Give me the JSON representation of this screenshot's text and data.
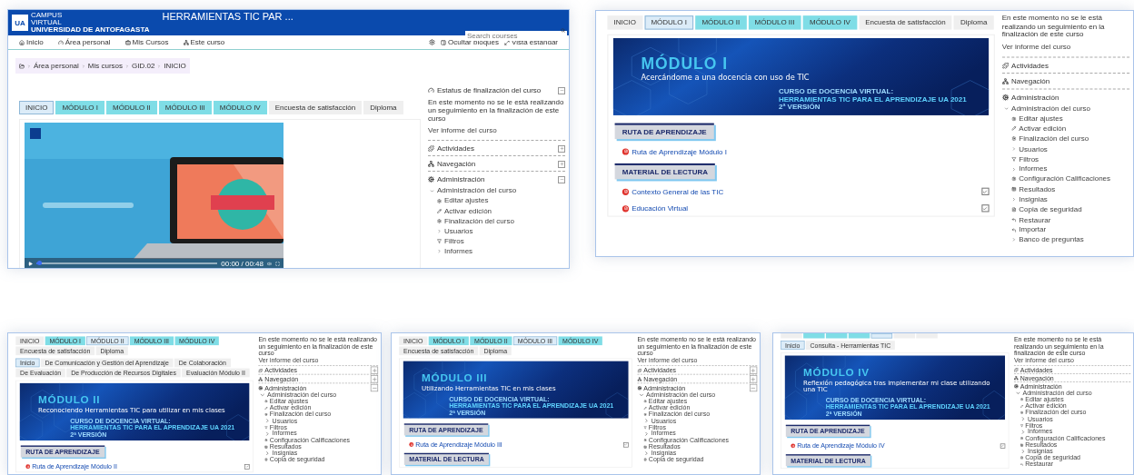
{
  "panels": [
    {
      "header": {
        "logo": "UA",
        "logo_lines": [
          "CAMPUS",
          "VIRTUAL",
          "UNIVERSIDAD DE ANTOFAGASTA"
        ],
        "title": "HERRAMIENTAS TIC PAR ...",
        "search_placeholder": "Search courses"
      },
      "nav": [
        "Inicio",
        "Área personal",
        "Mis Cursos",
        "Este curso"
      ],
      "nav_right": [
        "Ocultar bloques",
        "Vista estándar"
      ],
      "breadcrumb": [
        "Área personal",
        "Mis cursos",
        "GID.02",
        "INICIO"
      ],
      "tabs": [
        {
          "label": "INICIO",
          "kind": "page",
          "selected": true
        },
        {
          "label": "MÓDULO I",
          "kind": "module",
          "selected": false
        },
        {
          "label": "MÓDULO II",
          "kind": "module",
          "selected": false
        },
        {
          "label": "MÓDULO III",
          "kind": "module",
          "selected": false
        },
        {
          "label": "MÓDULO IV",
          "kind": "module",
          "selected": false
        },
        {
          "label": "Encuesta de satisfacción",
          "kind": "page",
          "selected": false
        },
        {
          "label": "Diploma",
          "kind": "page",
          "selected": false
        }
      ],
      "content": {
        "kind": "video",
        "time": "00:00 / 00:48",
        "level": 0.02
      },
      "sidebar": {
        "status": {
          "title": "Estatus de finalización del curso",
          "text": "En este momento no se le está realizando un seguimiento en la finalización de este curso",
          "link": "Ver informe del curso",
          "expanded": true
        },
        "blocks": [
          {
            "title": "Actividades",
            "expanded": false
          },
          {
            "title": "Navegación",
            "expanded": false
          },
          {
            "title": "Administración",
            "expanded": true,
            "items": [
              {
                "label": "Administración del curso",
                "expanded": true,
                "children": [
                  {
                    "label": "Editar ajustes"
                  },
                  {
                    "label": "Activar edición"
                  },
                  {
                    "label": "Finalización del curso"
                  },
                  {
                    "label": "Usuarios",
                    "expanded": false
                  },
                  {
                    "label": "Filtros"
                  },
                  {
                    "label": "Informes",
                    "expanded": false
                  }
                ]
              }
            ]
          }
        ]
      }
    },
    {
      "tabs": [
        {
          "label": "INICIO",
          "kind": "page",
          "selected": false
        },
        {
          "label": "MÓDULO I",
          "kind": "module",
          "selected": true
        },
        {
          "label": "MÓDULO II",
          "kind": "module",
          "selected": false
        },
        {
          "label": "MÓDULO III",
          "kind": "module",
          "selected": false
        },
        {
          "label": "MÓDULO IV",
          "kind": "module",
          "selected": false
        },
        {
          "label": "Encuesta de satisfacción",
          "kind": "page",
          "selected": false
        },
        {
          "label": "Diploma",
          "kind": "page",
          "selected": false
        }
      ],
      "content": {
        "kind": "module",
        "banner": {
          "title": "MÓDULO I",
          "subtitle": "Acercándome a una docencia con uso de TIC",
          "course_lines": [
            "CURSO DE DOCENCIA VIRTUAL:",
            "HERRAMIENTAS TIC PARA EL APRENDIZAJE UA 2021",
            "2ª VERSIÓN"
          ]
        },
        "sections": [
          {
            "heading": "RUTA DE APRENDIZAJE",
            "links": [
              {
                "text": "Ruta de Aprendizaje Módulo I"
              }
            ]
          },
          {
            "heading": "MATERIAL DE LECTURA",
            "links": [
              {
                "text": "Contexto General de las TIC",
                "completed": true
              },
              {
                "text": "Educación Virtual",
                "completed": true
              }
            ]
          }
        ]
      },
      "sidebar": {
        "status": {
          "text": "En este momento no se le está realizando un seguimiento en la finalización de este curso",
          "link": "Ver informe del curso"
        },
        "blocks": [
          {
            "title": "Actividades"
          },
          {
            "title": "Navegación"
          },
          {
            "title": "Administración",
            "items": [
              {
                "label": "Administración del curso",
                "expanded": true,
                "children": [
                  {
                    "label": "Editar ajustes"
                  },
                  {
                    "label": "Activar edición"
                  },
                  {
                    "label": "Finalización del curso"
                  },
                  {
                    "label": "Usuarios",
                    "expanded": false
                  },
                  {
                    "label": "Filtros"
                  },
                  {
                    "label": "Informes",
                    "expanded": false
                  },
                  {
                    "label": "Configuración Calificaciones"
                  },
                  {
                    "label": "Resultados"
                  },
                  {
                    "label": "Insignias",
                    "expanded": false
                  },
                  {
                    "label": "Copia de seguridad"
                  },
                  {
                    "label": "Restaurar"
                  },
                  {
                    "label": "Importar"
                  },
                  {
                    "label": "Banco de preguntas",
                    "expanded": false
                  }
                ]
              }
            ]
          }
        ]
      }
    },
    {
      "tabs": [
        {
          "label": "INICIO",
          "kind": "page",
          "selected": false
        },
        {
          "label": "MÓDULO I",
          "kind": "module",
          "selected": false
        },
        {
          "label": "MÓDULO II",
          "kind": "module",
          "selected": true
        },
        {
          "label": "MÓDULO III",
          "kind": "module",
          "selected": false
        },
        {
          "label": "MÓDULO IV",
          "kind": "module",
          "selected": false
        },
        {
          "label": "Encuesta de satisfacción",
          "kind": "page",
          "selected": false
        },
        {
          "label": "Diploma",
          "kind": "page",
          "selected": false
        }
      ],
      "subtabs": [
        {
          "label": "Inicio",
          "selected": true
        },
        {
          "label": "De Comunicación y Gestión del Aprendizaje",
          "selected": false
        },
        {
          "label": "De Colaboración",
          "selected": false
        },
        {
          "label": "De Evaluación",
          "selected": false
        },
        {
          "label": "De Producción de Recursos Digitales",
          "selected": false
        },
        {
          "label": "Evaluación Módulo II",
          "selected": false
        }
      ],
      "content": {
        "kind": "module",
        "banner": {
          "title": "MÓDULO II",
          "subtitle": "Reconociendo Herramientas TIC para utilizar en mis clases",
          "course_lines": [
            "CURSO DE DOCENCIA VIRTUAL:",
            "HERRAMIENTAS TIC PARA EL APRENDIZAJE UA 2021",
            "2ª VERSIÓN"
          ]
        },
        "sections": [
          {
            "heading": "RUTA DE APRENDIZAJE",
            "links": [
              {
                "text": "Ruta de Aprendizaje Módulo II",
                "completed": true
              }
            ]
          }
        ]
      },
      "sidebar": {
        "status": {
          "text": "En este momento no se le está realizando un seguimiento en la finalización de este curso",
          "link": "Ver informe del curso"
        },
        "blocks": [
          {
            "title": "Actividades",
            "expanded": false
          },
          {
            "title": "Navegación",
            "expanded": false
          },
          {
            "title": "Administración",
            "expanded": true,
            "items": [
              {
                "label": "Administración del curso",
                "expanded": true,
                "children": [
                  {
                    "label": "Editar ajustes"
                  },
                  {
                    "label": "Activar edición"
                  },
                  {
                    "label": "Finalización del curso"
                  },
                  {
                    "label": "Usuarios",
                    "expanded": false
                  },
                  {
                    "label": "Filtros"
                  },
                  {
                    "label": "Informes",
                    "expanded": false
                  },
                  {
                    "label": "Configuración Calificaciones"
                  },
                  {
                    "label": "Resultados"
                  },
                  {
                    "label": "Insignias",
                    "expanded": false
                  },
                  {
                    "label": "Copia de seguridad"
                  }
                ]
              }
            ]
          }
        ]
      }
    },
    {
      "tabs": [
        {
          "label": "INICIO",
          "kind": "page",
          "selected": false
        },
        {
          "label": "MÓDULO I",
          "kind": "module",
          "selected": false
        },
        {
          "label": "MÓDULO II",
          "kind": "module",
          "selected": false
        },
        {
          "label": "MÓDULO III",
          "kind": "module",
          "selected": true
        },
        {
          "label": "MÓDULO IV",
          "kind": "module",
          "selected": false
        },
        {
          "label": "Encuesta de satisfacción",
          "kind": "page",
          "selected": false
        },
        {
          "label": "Diploma",
          "kind": "page",
          "selected": false
        }
      ],
      "content": {
        "kind": "module",
        "banner": {
          "title": "MÓDULO III",
          "subtitle": "Utilizando Herramientas TIC en mis clases",
          "course_lines": [
            "CURSO DE DOCENCIA VIRTUAL:",
            "HERRAMIENTAS TIC PARA EL APRENDIZAJE UA 2021",
            "2ª VERSIÓN"
          ]
        },
        "sections": [
          {
            "heading": "RUTA DE APRENDIZAJE",
            "links": [
              {
                "text": "Ruta de Aprendizaje Módulo III",
                "completed": true
              }
            ]
          },
          {
            "heading": "MATERIAL DE LECTURA"
          }
        ]
      },
      "sidebar": {
        "status": {
          "text": "En este momento no se le está realizando un seguimiento en la finalización de este curso",
          "link": "Ver informe del curso"
        },
        "blocks": [
          {
            "title": "Actividades",
            "expanded": false
          },
          {
            "title": "Navegación",
            "expanded": false
          },
          {
            "title": "Administración",
            "expanded": true,
            "items": [
              {
                "label": "Administración del curso",
                "expanded": true,
                "children": [
                  {
                    "label": "Editar ajustes"
                  },
                  {
                    "label": "Activar edición"
                  },
                  {
                    "label": "Finalización del curso"
                  },
                  {
                    "label": "Usuarios",
                    "expanded": false
                  },
                  {
                    "label": "Filtros"
                  },
                  {
                    "label": "Informes",
                    "expanded": false
                  },
                  {
                    "label": "Configuración Calificaciones"
                  },
                  {
                    "label": "Resultados"
                  },
                  {
                    "label": "Insignias",
                    "expanded": false
                  },
                  {
                    "label": "Copia de seguridad"
                  }
                ]
              }
            ]
          }
        ]
      }
    },
    {
      "tabs": [
        {
          "kind": "page",
          "selected": false
        },
        {
          "kind": "module",
          "selected": false
        },
        {
          "kind": "module",
          "selected": false
        },
        {
          "kind": "module",
          "selected": false
        },
        {
          "kind": "module",
          "selected": true
        },
        {
          "kind": "page",
          "selected": false
        },
        {
          "kind": "page",
          "selected": false
        }
      ],
      "subtabs": [
        {
          "label": "Inicio",
          "selected": true
        },
        {
          "label": "Consulta - Herramientas TIC",
          "selected": false
        }
      ],
      "content": {
        "kind": "module",
        "banner": {
          "title": "MÓDULO IV",
          "subtitle": "Reflexión pedagógica tras implementar mi clase utilizando una TIC",
          "course_lines": [
            "CURSO DE DOCENCIA VIRTUAL:",
            "HERRAMIENTAS TIC PARA EL APRENDIZAJE UA 2021",
            "2ª VERSIÓN"
          ]
        },
        "sections": [
          {
            "heading": "RUTA DE APRENDIZAJE",
            "links": [
              {
                "text": "Ruta de Aprendizaje Módulo IV",
                "completed": true
              }
            ]
          },
          {
            "heading": "MATERIAL DE LECTURA"
          }
        ]
      },
      "sidebar": {
        "status": {
          "text": "En este momento no se le está realizando un seguimiento en la finalización de este curso",
          "link": "Ver informe del curso"
        },
        "blocks": [
          {
            "title": "Actividades"
          },
          {
            "title": "Navegación"
          },
          {
            "title": "Administración",
            "items": [
              {
                "label": "Administración del curso",
                "expanded": true,
                "children": [
                  {
                    "label": "Editar ajustes"
                  },
                  {
                    "label": "Activar edición"
                  },
                  {
                    "label": "Finalización del curso"
                  },
                  {
                    "label": "Usuarios",
                    "expanded": false
                  },
                  {
                    "label": "Filtros"
                  },
                  {
                    "label": "Informes",
                    "expanded": false
                  },
                  {
                    "label": "Configuración Calificaciones"
                  },
                  {
                    "label": "Resultados"
                  },
                  {
                    "label": "Insignias",
                    "expanded": false
                  },
                  {
                    "label": "Copia de seguridad"
                  },
                  {
                    "label": "Restaurar"
                  }
                ]
              }
            ]
          }
        ]
      }
    }
  ]
}
